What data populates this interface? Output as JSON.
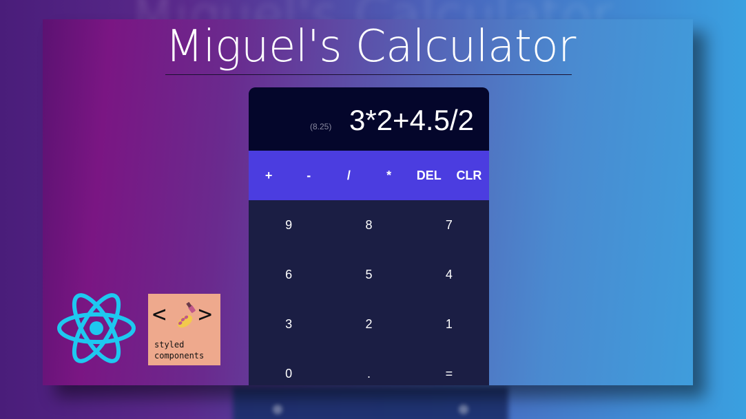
{
  "page": {
    "title": "Miguel's Calculator"
  },
  "calculator": {
    "display": {
      "preview": "(8.25)",
      "expression": "3*2+4.5/2"
    },
    "operators": [
      "+",
      "-",
      "/",
      "*",
      "DEL",
      "CLR"
    ],
    "digits": [
      "9",
      "8",
      "7",
      "6",
      "5",
      "4",
      "3",
      "2",
      "1",
      "0",
      ".",
      "="
    ]
  },
  "logos": {
    "react": "react-icon",
    "styled_components": {
      "brackets_left": "<",
      "brackets_right": ">",
      "text_line1": "styled",
      "text_line2": "components"
    }
  },
  "colors": {
    "display_bg": "#04062b",
    "operators_bg": "#4b3de0",
    "keypad_bg": "#1b1e44",
    "react_blue": "#1ec8f0",
    "styled_components_bg": "#eea98d"
  }
}
